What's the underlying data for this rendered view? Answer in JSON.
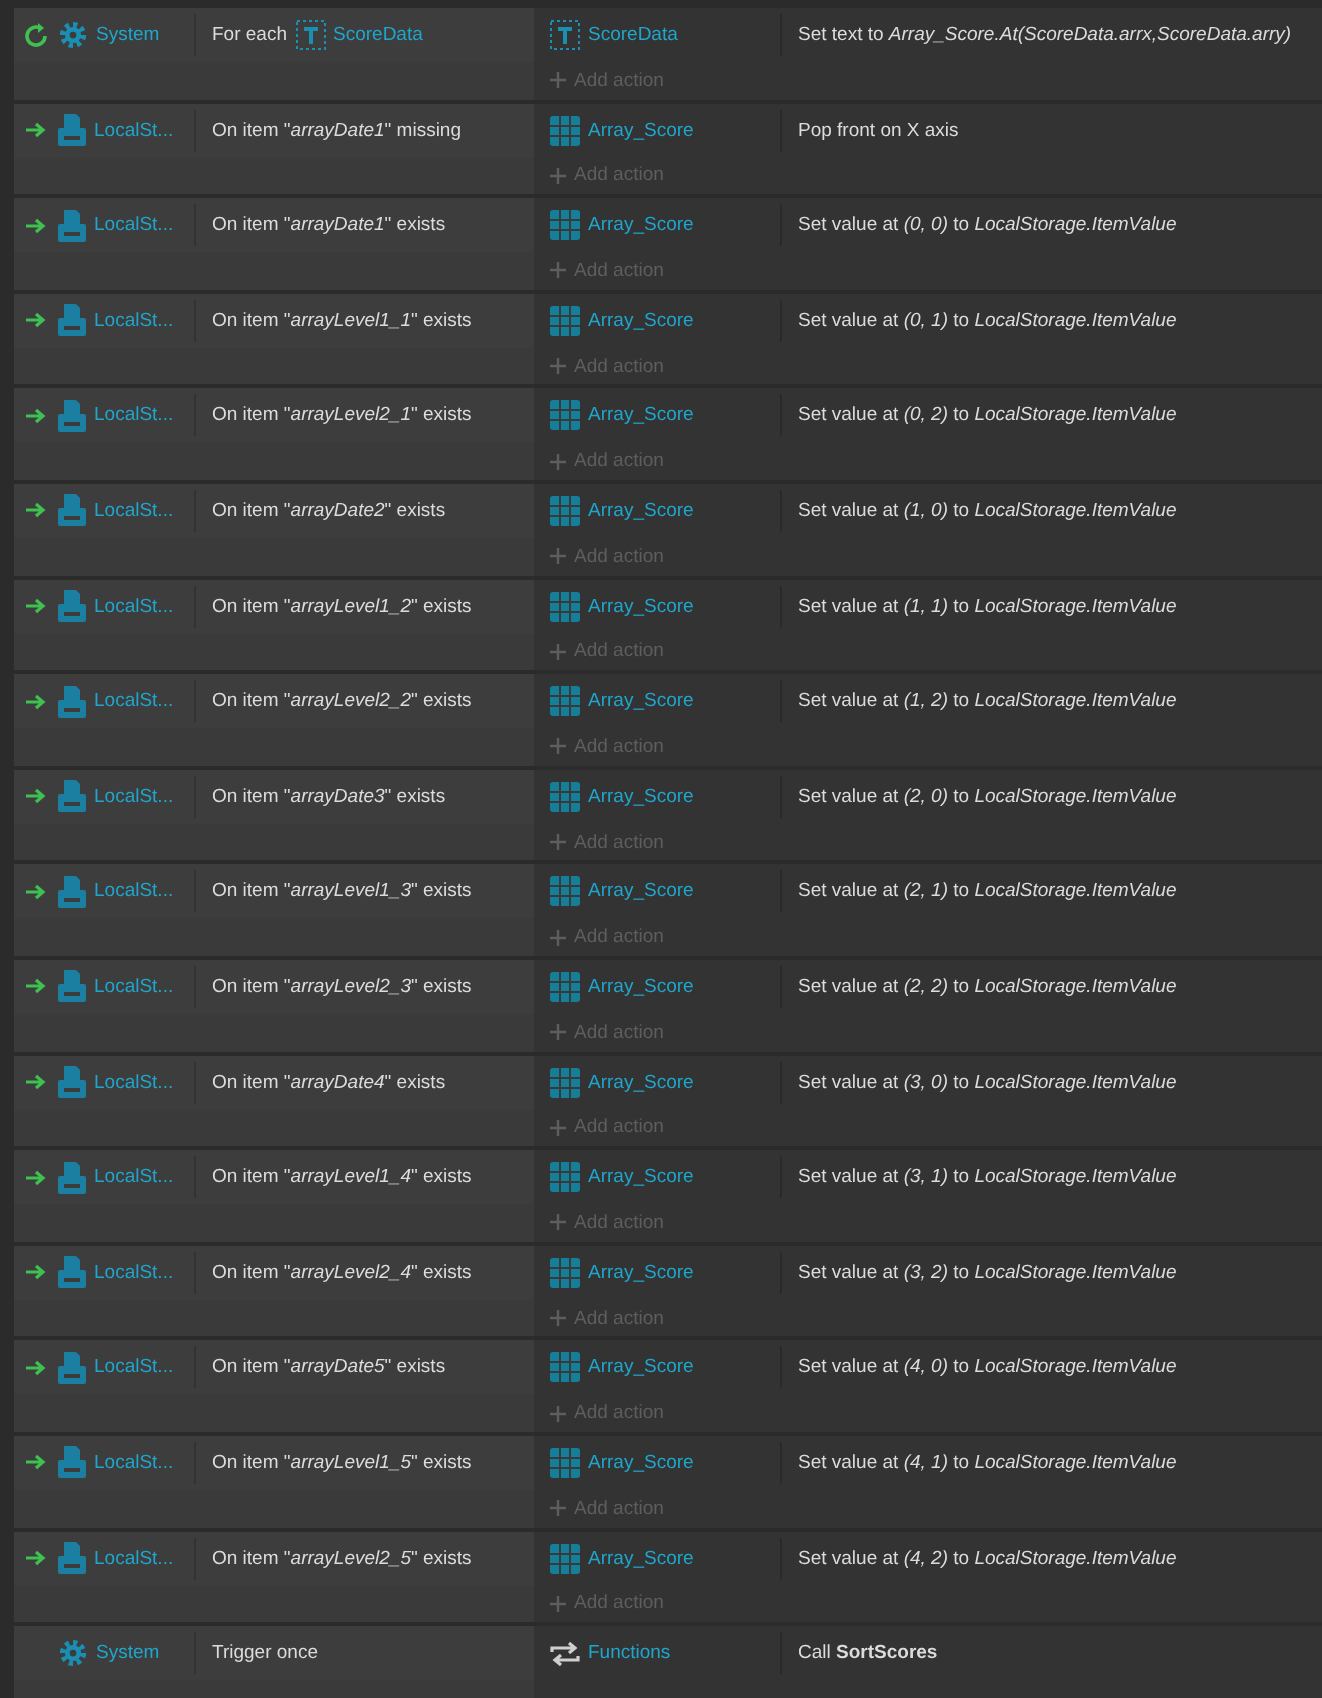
{
  "events": [
    {
      "kind": "loop",
      "object": {
        "kind": "gear",
        "name": "System"
      },
      "condition": {
        "text": "For each",
        "param": {
          "kind": "text",
          "name": "ScoreData"
        }
      },
      "action": {
        "object": {
          "kind": "text",
          "name": "ScoreData"
        },
        "text": "Set text to *Array_Score.At(ScoreData.arrx,ScoreData.arry)*"
      },
      "add_action": "Add action"
    },
    {
      "kind": "trigger",
      "object": {
        "kind": "storage",
        "name": "LocalSt..."
      },
      "condition": {
        "text": "On item \"*arrayDate1*\" missing"
      },
      "action": {
        "object": {
          "kind": "array",
          "name": "Array_Score"
        },
        "text": "Pop front on X axis"
      },
      "add_action": "Add action"
    },
    {
      "kind": "trigger",
      "object": {
        "kind": "storage",
        "name": "LocalSt..."
      },
      "condition": {
        "text": "On item \"*arrayDate1*\" exists"
      },
      "action": {
        "object": {
          "kind": "array",
          "name": "Array_Score"
        },
        "text": "Set value at *(0, 0)* to *LocalStorage.ItemValue*"
      },
      "add_action": "Add action"
    },
    {
      "kind": "trigger",
      "object": {
        "kind": "storage",
        "name": "LocalSt..."
      },
      "condition": {
        "text": "On item \"*arrayLevel1_1*\" exists"
      },
      "action": {
        "object": {
          "kind": "array",
          "name": "Array_Score"
        },
        "text": "Set value at *(0, 1)* to *LocalStorage.ItemValue*"
      },
      "add_action": "Add action"
    },
    {
      "kind": "trigger",
      "object": {
        "kind": "storage",
        "name": "LocalSt..."
      },
      "condition": {
        "text": "On item \"*arrayLevel2_1*\" exists"
      },
      "action": {
        "object": {
          "kind": "array",
          "name": "Array_Score"
        },
        "text": "Set value at *(0, 2)* to *LocalStorage.ItemValue*"
      },
      "add_action": "Add action"
    },
    {
      "kind": "trigger",
      "object": {
        "kind": "storage",
        "name": "LocalSt..."
      },
      "condition": {
        "text": "On item \"*arrayDate2*\" exists"
      },
      "action": {
        "object": {
          "kind": "array",
          "name": "Array_Score"
        },
        "text": "Set value at *(1, 0)* to *LocalStorage.ItemValue*"
      },
      "add_action": "Add action"
    },
    {
      "kind": "trigger",
      "object": {
        "kind": "storage",
        "name": "LocalSt..."
      },
      "condition": {
        "text": "On item \"*arrayLevel1_2*\" exists"
      },
      "action": {
        "object": {
          "kind": "array",
          "name": "Array_Score"
        },
        "text": "Set value at *(1, 1)* to *LocalStorage.ItemValue*"
      },
      "add_action": "Add action"
    },
    {
      "kind": "trigger",
      "object": {
        "kind": "storage",
        "name": "LocalSt..."
      },
      "condition": {
        "text": "On item \"*arrayLevel2_2*\" exists"
      },
      "action": {
        "object": {
          "kind": "array",
          "name": "Array_Score"
        },
        "text": "Set value at *(1, 2)* to *LocalStorage.ItemValue*"
      },
      "add_action": "Add action"
    },
    {
      "kind": "trigger",
      "object": {
        "kind": "storage",
        "name": "LocalSt..."
      },
      "condition": {
        "text": "On item \"*arrayDate3*\" exists"
      },
      "action": {
        "object": {
          "kind": "array",
          "name": "Array_Score"
        },
        "text": "Set value at *(2, 0)* to *LocalStorage.ItemValue*"
      },
      "add_action": "Add action"
    },
    {
      "kind": "trigger",
      "object": {
        "kind": "storage",
        "name": "LocalSt..."
      },
      "condition": {
        "text": "On item \"*arrayLevel1_3*\" exists"
      },
      "action": {
        "object": {
          "kind": "array",
          "name": "Array_Score"
        },
        "text": "Set value at *(2, 1)* to *LocalStorage.ItemValue*"
      },
      "add_action": "Add action"
    },
    {
      "kind": "trigger",
      "object": {
        "kind": "storage",
        "name": "LocalSt..."
      },
      "condition": {
        "text": "On item \"*arrayLevel2_3*\" exists"
      },
      "action": {
        "object": {
          "kind": "array",
          "name": "Array_Score"
        },
        "text": "Set value at *(2, 2)* to *LocalStorage.ItemValue*"
      },
      "add_action": "Add action"
    },
    {
      "kind": "trigger",
      "object": {
        "kind": "storage",
        "name": "LocalSt..."
      },
      "condition": {
        "text": "On item \"*arrayDate4*\" exists"
      },
      "action": {
        "object": {
          "kind": "array",
          "name": "Array_Score"
        },
        "text": "Set value at *(3, 0)* to *LocalStorage.ItemValue*"
      },
      "add_action": "Add action"
    },
    {
      "kind": "trigger",
      "object": {
        "kind": "storage",
        "name": "LocalSt..."
      },
      "condition": {
        "text": "On item \"*arrayLevel1_4*\" exists"
      },
      "action": {
        "object": {
          "kind": "array",
          "name": "Array_Score"
        },
        "text": "Set value at *(3, 1)* to *LocalStorage.ItemValue*"
      },
      "add_action": "Add action"
    },
    {
      "kind": "trigger",
      "object": {
        "kind": "storage",
        "name": "LocalSt..."
      },
      "condition": {
        "text": "On item \"*arrayLevel2_4*\" exists"
      },
      "action": {
        "object": {
          "kind": "array",
          "name": "Array_Score"
        },
        "text": "Set value at *(3, 2)* to *LocalStorage.ItemValue*"
      },
      "add_action": "Add action"
    },
    {
      "kind": "trigger",
      "object": {
        "kind": "storage",
        "name": "LocalSt..."
      },
      "condition": {
        "text": "On item \"*arrayDate5*\" exists"
      },
      "action": {
        "object": {
          "kind": "array",
          "name": "Array_Score"
        },
        "text": "Set value at *(4, 0)* to *LocalStorage.ItemValue*"
      },
      "add_action": "Add action"
    },
    {
      "kind": "trigger",
      "object": {
        "kind": "storage",
        "name": "LocalSt..."
      },
      "condition": {
        "text": "On item \"*arrayLevel1_5*\" exists"
      },
      "action": {
        "object": {
          "kind": "array",
          "name": "Array_Score"
        },
        "text": "Set value at *(4, 1)* to *LocalStorage.ItemValue*"
      },
      "add_action": "Add action"
    },
    {
      "kind": "trigger",
      "object": {
        "kind": "storage",
        "name": "LocalSt..."
      },
      "condition": {
        "text": "On item \"*arrayLevel2_5*\" exists"
      },
      "action": {
        "object": {
          "kind": "array",
          "name": "Array_Score"
        },
        "text": "Set value at *(4, 2)* to *LocalStorage.ItemValue*"
      },
      "add_action": "Add action"
    },
    {
      "kind": "plain",
      "object": {
        "kind": "gear",
        "name": "System"
      },
      "condition": {
        "text": "Trigger once"
      },
      "action": {
        "object": {
          "kind": "functions",
          "name": "Functions"
        },
        "text": "Call **SortScores**"
      }
    }
  ]
}
